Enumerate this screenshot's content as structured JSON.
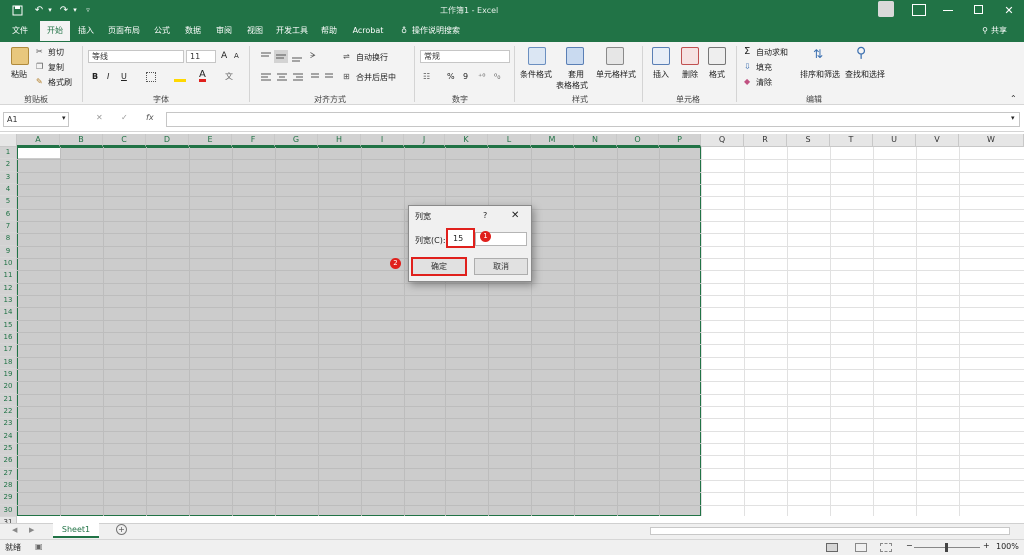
{
  "title_bar": {
    "title": "工作簿1 - Excel",
    "undo_icon": "undo-icon",
    "redo_icon": "redo-icon",
    "save_icon": "save-icon"
  },
  "ribbon_tabs": [
    "文件",
    "开始",
    "插入",
    "页面布局",
    "公式",
    "数据",
    "审阅",
    "视图",
    "开发工具",
    "帮助",
    "Acrobat"
  ],
  "active_tab": "开始",
  "tell_me": "操作说明搜索",
  "share": "共享",
  "clipboard": {
    "paste": "粘贴",
    "cut": "剪切",
    "copy": "复制",
    "format_painter": "格式刷",
    "group": "剪贴板"
  },
  "font": {
    "name": "等线",
    "size": "11",
    "bold": "B",
    "italic": "I",
    "underline": "U",
    "increase": "A",
    "decrease": "A",
    "font_color_glyph": "A",
    "group": "字体"
  },
  "alignment": {
    "wrap": "自动换行",
    "merge": "合并后居中",
    "group": "对齐方式"
  },
  "number": {
    "format": "常规",
    "percent": "%",
    "comma": "9",
    "group": "数字"
  },
  "styles": {
    "conditional": "条件格式",
    "table_line1": "套用",
    "table_line2": "表格格式",
    "cell_styles": "单元格样式",
    "group": "样式"
  },
  "cells": {
    "insert": "插入",
    "delete": "删除",
    "format": "格式",
    "group": "单元格"
  },
  "editing": {
    "autosum": "自动求和",
    "fill": "填充",
    "clear": "清除",
    "sort": "排序和筛选",
    "find": "查找和选择",
    "group": "编辑"
  },
  "formula_bar": {
    "name_box": "A1",
    "fx": "fx",
    "cancel": "✕",
    "enter": "✓"
  },
  "columns": [
    "A",
    "B",
    "C",
    "D",
    "E",
    "F",
    "G",
    "H",
    "I",
    "J",
    "K",
    "L",
    "M",
    "N",
    "O",
    "P",
    "Q",
    "R",
    "S",
    "T",
    "U",
    "V",
    "W"
  ],
  "rows": [
    "1",
    "2",
    "3",
    "4",
    "5",
    "6",
    "7",
    "8",
    "9",
    "10",
    "11",
    "12",
    "13",
    "14",
    "15",
    "16",
    "17",
    "18",
    "19",
    "20",
    "21",
    "22",
    "23",
    "24",
    "25",
    "26",
    "27",
    "28",
    "29",
    "30",
    "31"
  ],
  "dialog": {
    "title": "列宽",
    "help": "?",
    "close": "✕",
    "label": "列宽(C):",
    "value": "15",
    "ok": "确定",
    "cancel": "取消",
    "badge1": "1",
    "badge2": "2"
  },
  "sheet_tabs": [
    "Sheet1"
  ],
  "add_sheet": "+",
  "status": {
    "ready": "就绪",
    "zoom": "100%",
    "minus": "−",
    "plus": "+"
  },
  "colors": {
    "excel_green": "#217346",
    "selection_gray": "#cccccc",
    "highlight_red": "#e0201c"
  }
}
